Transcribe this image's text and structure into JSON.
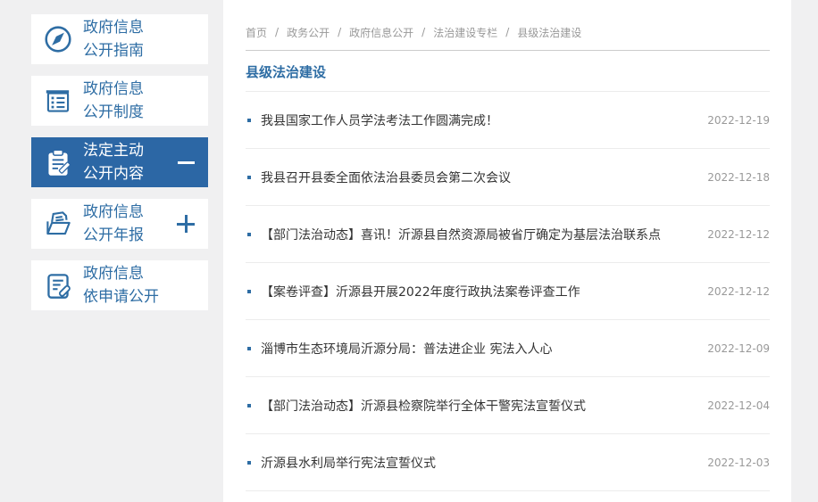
{
  "theme": {
    "bg": "#f0f0f1",
    "panel": "#ffffff",
    "accent": "#2e6da4",
    "active_bg": "#2c67a5",
    "text": "#333333",
    "muted": "#999999",
    "divider": "#ececec",
    "crumb_line": "#cccccc"
  },
  "sidebar": {
    "items": [
      {
        "line1": "政府信息",
        "line2": "公开指南",
        "icon": "compass-icon",
        "active": false,
        "toggle": ""
      },
      {
        "line1": "政府信息",
        "line2": "公开制度",
        "icon": "document-list-icon",
        "active": false,
        "toggle": ""
      },
      {
        "line1": "法定主动",
        "line2": "公开内容",
        "icon": "clipboard-pen-icon",
        "active": true,
        "toggle": "minus"
      },
      {
        "line1": "政府信息",
        "line2": "公开年报",
        "icon": "folder-file-icon",
        "active": false,
        "toggle": "plus"
      },
      {
        "line1": "政府信息",
        "line2": "依申请公开",
        "icon": "document-pen-icon",
        "active": false,
        "toggle": ""
      }
    ]
  },
  "breadcrumb": {
    "separator": "/",
    "items": [
      "首页",
      "政务公开",
      "政府信息公开",
      "法治建设专栏",
      "县级法治建设"
    ]
  },
  "main": {
    "title": "县级法治建设",
    "articles": [
      {
        "title": "我县国家工作人员学法考法工作圆满完成！",
        "date": "2022-12-19"
      },
      {
        "title": "我县召开县委全面依法治县委员会第二次会议",
        "date": "2022-12-18"
      },
      {
        "title": "【部门法治动态】喜讯！沂源县自然资源局被省厅确定为基层法治联系点",
        "date": "2022-12-12"
      },
      {
        "title": "【案卷评查】沂源县开展2022年度行政执法案卷评查工作",
        "date": "2022-12-12"
      },
      {
        "title": "淄博市生态环境局沂源分局：普法进企业 宪法入人心",
        "date": "2022-12-09"
      },
      {
        "title": "【部门法治动态】沂源县检察院举行全体干警宪法宣誓仪式",
        "date": "2022-12-04"
      },
      {
        "title": "沂源县水利局举行宪法宣誓仪式",
        "date": "2022-12-03"
      }
    ]
  }
}
